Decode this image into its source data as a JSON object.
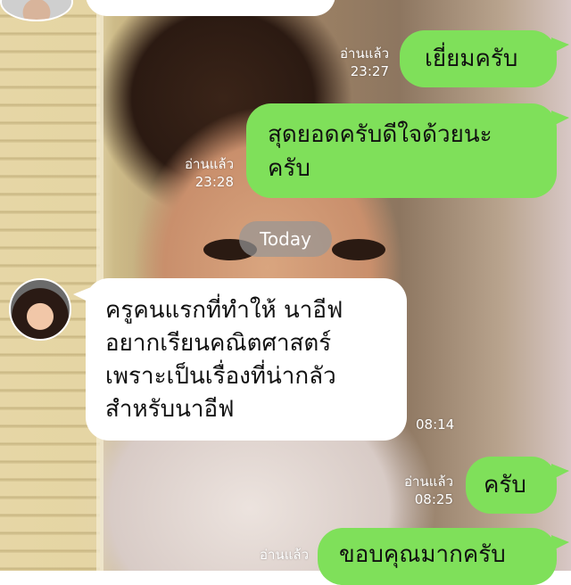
{
  "chat": {
    "divider": "Today",
    "messages": [
      {
        "id": "m1",
        "direction": "outgoing",
        "text": "เยี่ยมครับ",
        "status": "อ่านแล้ว",
        "time": "23:27"
      },
      {
        "id": "m2",
        "direction": "outgoing",
        "text_lines": [
          "สุดยอดครับดีใจด้วยนะ",
          "ครับ"
        ],
        "status": "อ่านแล้ว",
        "time": "23:28"
      },
      {
        "id": "m3",
        "direction": "incoming",
        "text_lines": [
          "ครูคนแรกที่ทำให้ นาอีฟ",
          "อยากเรียนคณิตศาสตร์",
          "เพราะเป็นเรื่องที่น่ากลัว",
          "สำหรับนาอีฟ"
        ],
        "time": "08:14"
      },
      {
        "id": "m4",
        "direction": "outgoing",
        "text": "ครับ",
        "status": "อ่านแล้ว",
        "time": "08:25"
      },
      {
        "id": "m5",
        "direction": "outgoing",
        "text": "ขอบคุณมากครับ",
        "status": "อ่านแล้ว"
      }
    ]
  },
  "colors": {
    "outgoing_bubble": "#7fe05a",
    "incoming_bubble": "#ffffff",
    "divider_pill": "#969696"
  }
}
